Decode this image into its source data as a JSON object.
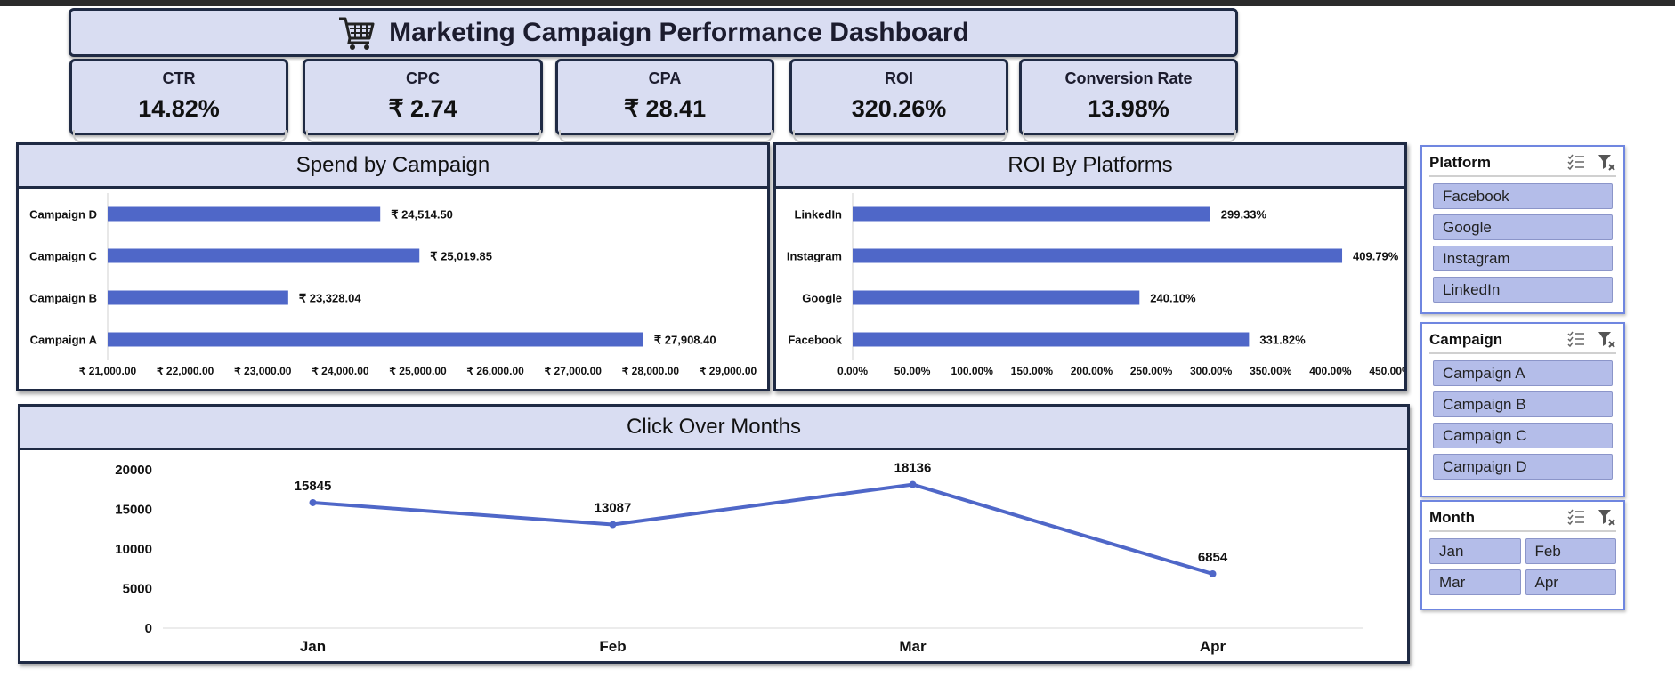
{
  "title": "Marketing Campaign Performance Dashboard",
  "kpis": [
    {
      "label": "CTR",
      "value": "14.82%"
    },
    {
      "label": "CPC",
      "value": "₹ 2.74"
    },
    {
      "label": "CPA",
      "value": "₹ 28.41"
    },
    {
      "label": "ROI",
      "value": "320.26%"
    },
    {
      "label": "Conversion Rate",
      "value": "13.98%"
    }
  ],
  "colors": {
    "accent": "#4f67c8",
    "panel_header": "#d9ddf2",
    "border": "#1f2a44",
    "slicer_item": "#b4bde9"
  },
  "chart_data": [
    {
      "type": "bar",
      "orientation": "horizontal",
      "title": "Spend by Campaign",
      "categories": [
        "Campaign A",
        "Campaign B",
        "Campaign C",
        "Campaign D"
      ],
      "values": [
        27908.4,
        23328.04,
        25019.85,
        24514.5
      ],
      "value_labels": [
        "₹ 27,908.40",
        "₹ 23,328.04",
        "₹ 25,019.85",
        "₹ 24,514.50"
      ],
      "xlim": [
        21000,
        29000
      ],
      "tick_labels": [
        "₹ 21,000.00",
        "₹ 22,000.00",
        "₹ 23,000.00",
        "₹ 24,000.00",
        "₹ 25,000.00",
        "₹ 26,000.00",
        "₹ 27,000.00",
        "₹ 28,000.00",
        "₹ 29,000.00"
      ],
      "grid": false
    },
    {
      "type": "bar",
      "orientation": "horizontal",
      "title": "ROI By Platforms",
      "categories": [
        "Facebook",
        "Google",
        "Instagram",
        "LinkedIn"
      ],
      "values": [
        331.82,
        240.1,
        409.79,
        299.33
      ],
      "value_labels": [
        "331.82%",
        "240.10%",
        "409.79%",
        "299.33%"
      ],
      "xlim": [
        0,
        450
      ],
      "tick_labels": [
        "0.00%",
        "50.00%",
        "100.00%",
        "150.00%",
        "200.00%",
        "250.00%",
        "300.00%",
        "350.00%",
        "400.00%",
        "450.00%"
      ],
      "grid": false
    },
    {
      "type": "line",
      "title": "Click Over Months",
      "x": [
        "Jan",
        "Feb",
        "Mar",
        "Apr"
      ],
      "values": [
        15845,
        13087,
        18136,
        6854
      ],
      "ylim": [
        0,
        20000
      ],
      "y_ticks": [
        "0",
        "5000",
        "10000",
        "15000",
        "20000"
      ],
      "grid": false
    }
  ],
  "slicers": {
    "platform": {
      "title": "Platform",
      "items": [
        "Facebook",
        "Google",
        "Instagram",
        "LinkedIn"
      ]
    },
    "campaign": {
      "title": "Campaign",
      "items": [
        "Campaign A",
        "Campaign B",
        "Campaign C",
        "Campaign D"
      ]
    },
    "month": {
      "title": "Month",
      "items": [
        "Jan",
        "Feb",
        "Mar",
        "Apr"
      ]
    },
    "icons": [
      "multi-select-icon",
      "clear-filter-icon"
    ]
  }
}
